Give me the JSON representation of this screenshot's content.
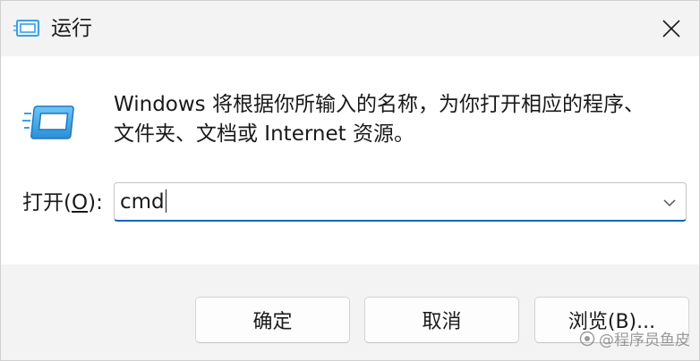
{
  "window": {
    "title": "运行",
    "title_icon": "run-dialog-icon",
    "close_icon": "close-icon"
  },
  "description": {
    "line1": "Windows 将根据你所输入的名称，为你打开相应的程序、",
    "line2": "文件夹、文档或 Internet 资源。"
  },
  "open_field": {
    "label_prefix": "打开(",
    "label_accel": "O",
    "label_suffix": "):",
    "value": "cmd",
    "dropdown_icon": "chevron-down-icon"
  },
  "buttons": {
    "ok": "确定",
    "cancel": "取消",
    "browse": "浏览(B)..."
  },
  "watermark": {
    "text": "@程序员鱼皮"
  },
  "colors": {
    "titlebar_bg": "#f3f3f3",
    "footer_bg": "#f3f3f3",
    "input_focus": "#0067c0",
    "icon_blue": "#3aa0e6"
  }
}
